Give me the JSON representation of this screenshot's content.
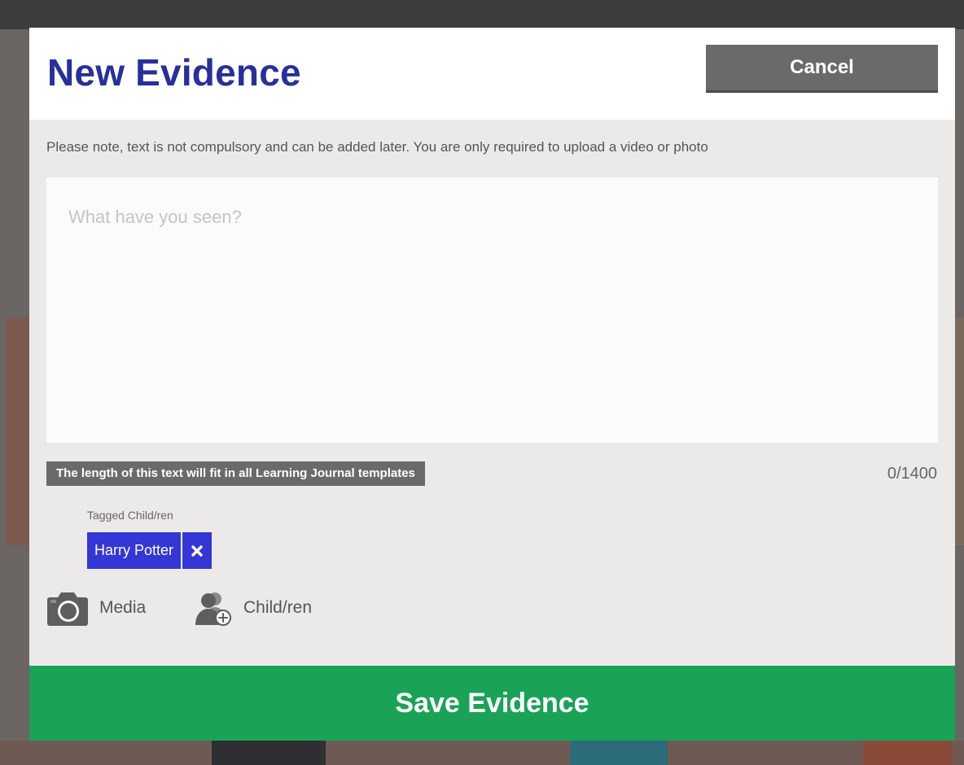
{
  "modal": {
    "title": "New Evidence",
    "cancel_label": "Cancel",
    "note": "Please note, text is not compulsory and can be added later. You are only required to upload a video or photo",
    "textarea": {
      "placeholder": "What have you seen?",
      "value": ""
    },
    "length_note": "The length of this text will fit in all Learning Journal templates",
    "char_counter": "0/1400",
    "tagged_label": "Tagged Child/ren",
    "tags": [
      {
        "name": "Harry Potter"
      }
    ],
    "actions": {
      "media_label": "Media",
      "children_label": "Child/ren"
    },
    "save_label": "Save Evidence"
  },
  "colors": {
    "title": "#27309a",
    "tag_chip": "#3436d6",
    "save_button": "#1aa356",
    "cancel_button": "#6a6a6a"
  },
  "icons": [
    "camera-icon",
    "add-child-icon",
    "close-icon"
  ]
}
